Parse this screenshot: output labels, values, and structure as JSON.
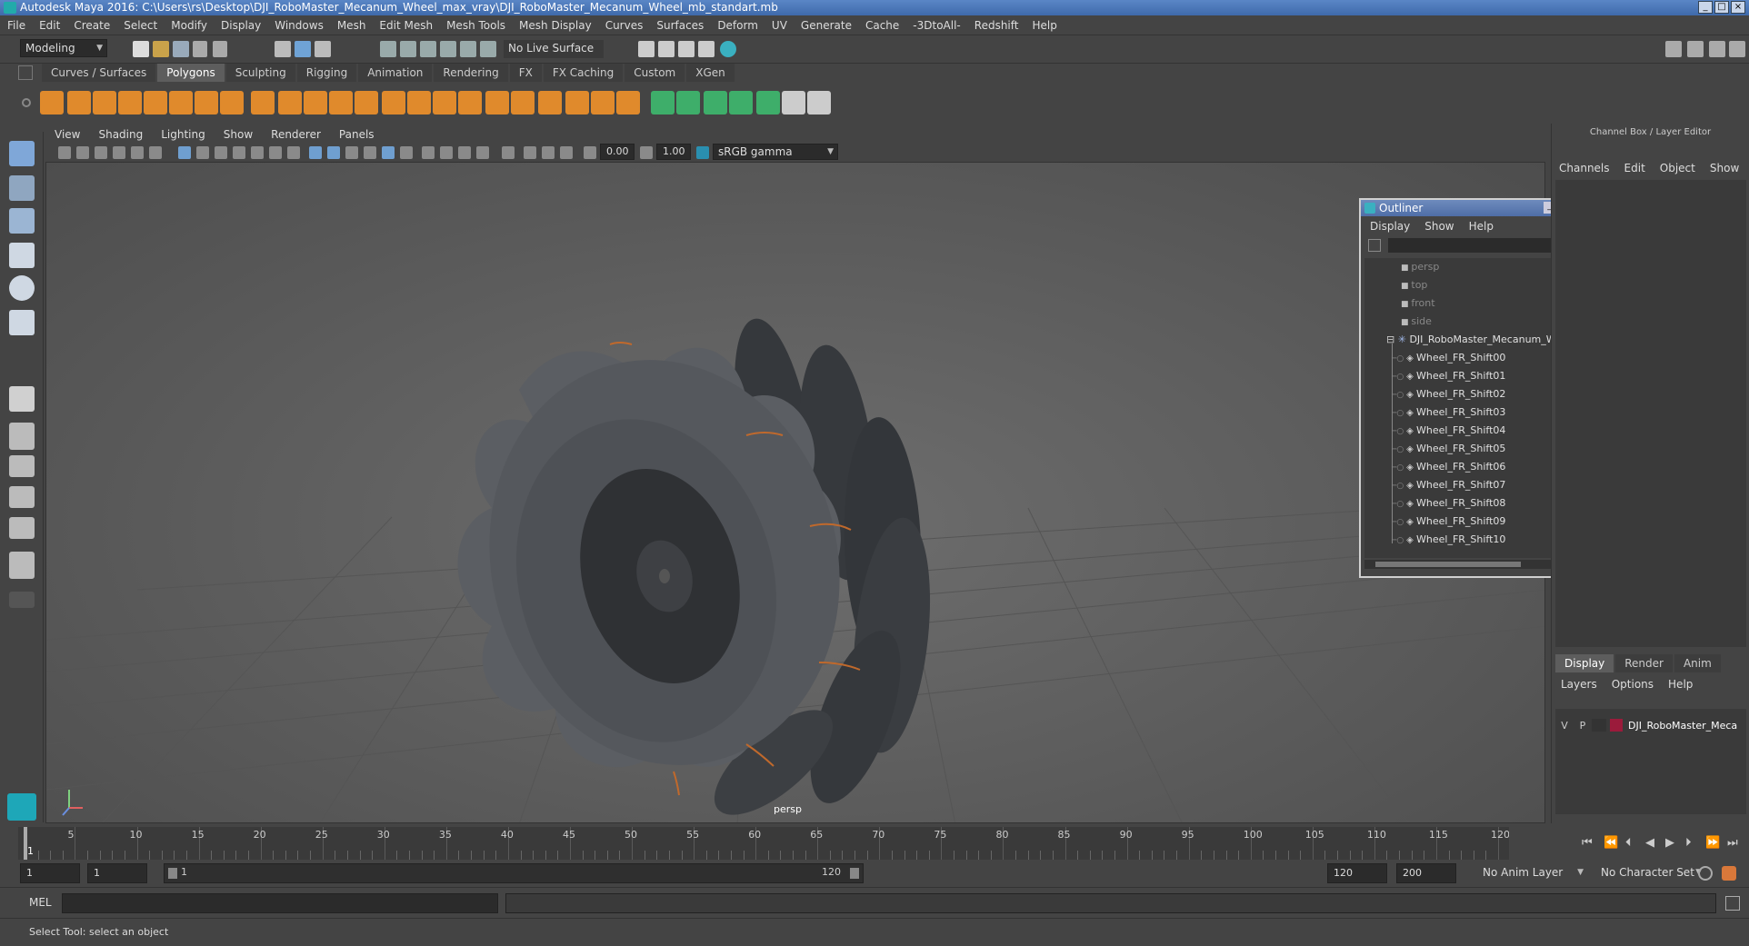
{
  "window": {
    "title": "Autodesk Maya 2016: C:\\Users\\rs\\Desktop\\DJI_RoboMaster_Mecanum_Wheel_max_vray\\DJI_RoboMaster_Mecanum_Wheel_mb_standart.mb"
  },
  "menubar": [
    "File",
    "Edit",
    "Create",
    "Select",
    "Modify",
    "Display",
    "Windows",
    "Mesh",
    "Edit Mesh",
    "Mesh Tools",
    "Mesh Display",
    "Curves",
    "Surfaces",
    "Deform",
    "UV",
    "Generate",
    "Cache",
    "-3DtoAll-",
    "Redshift",
    "Help"
  ],
  "statusline": {
    "mode": "Modeling",
    "live_surface": "No Live Surface"
  },
  "shelf_tabs": [
    "Curves / Surfaces",
    "Polygons",
    "Sculpting",
    "Rigging",
    "Animation",
    "Rendering",
    "FX",
    "FX Caching",
    "Custom",
    "XGen"
  ],
  "shelf_active": "Polygons",
  "panel_menu": [
    "View",
    "Shading",
    "Lighting",
    "Show",
    "Renderer",
    "Panels"
  ],
  "panel_toolbar": {
    "exposure": "0.00",
    "gamma": "1.00",
    "color_space": "sRGB gamma"
  },
  "viewport": {
    "camera_label": "persp"
  },
  "channel_box": {
    "title": "Channel Box / Layer Editor",
    "tabs": [
      "Channels",
      "Edit",
      "Object",
      "Show"
    ]
  },
  "layer_editor": {
    "tabs": [
      "Display",
      "Render",
      "Anim"
    ],
    "active_tab": "Display",
    "menu": [
      "Layers",
      "Options",
      "Help"
    ],
    "layer": {
      "v": "V",
      "p": "P",
      "name": "DJI_RoboMaster_Meca",
      "color": "#9b1b3b"
    }
  },
  "outliner": {
    "title": "Outliner",
    "menu": [
      "Display",
      "Show",
      "Help"
    ],
    "cameras": [
      "persp",
      "top",
      "front",
      "side"
    ],
    "group": "DJI_RoboMaster_Mecanum_Whee",
    "children": [
      "Wheel_FR_Shift00",
      "Wheel_FR_Shift01",
      "Wheel_FR_Shift02",
      "Wheel_FR_Shift03",
      "Wheel_FR_Shift04",
      "Wheel_FR_Shift05",
      "Wheel_FR_Shift06",
      "Wheel_FR_Shift07",
      "Wheel_FR_Shift08",
      "Wheel_FR_Shift09",
      "Wheel_FR_Shift10"
    ]
  },
  "timeline": {
    "labels": [
      "5",
      "10",
      "15",
      "20",
      "25",
      "30",
      "35",
      "40",
      "45",
      "50",
      "55",
      "60",
      "65",
      "70",
      "75",
      "80",
      "85",
      "90",
      "95",
      "100",
      "105",
      "110",
      "115",
      "120"
    ],
    "current_frame_marker": "1",
    "current_frame_field": "1"
  },
  "range": {
    "start": "1",
    "anim_start": "1",
    "slider_start": "1",
    "slider_end": "120",
    "end": "120",
    "anim_end": "200",
    "anim_layer": "No Anim Layer",
    "character_set": "No Character Set"
  },
  "cmdline": {
    "label": "MEL"
  },
  "helpline": {
    "text": "Select Tool: select an object"
  },
  "colors": {
    "accent": "#5285c6",
    "bg": "#444444",
    "shelf_orange": "#e08a2c",
    "shelf_green": "#3eae6a",
    "wheel_rim": "#5b5e63",
    "wheel_roller": "#383b3f",
    "copper": "#c0692c"
  }
}
